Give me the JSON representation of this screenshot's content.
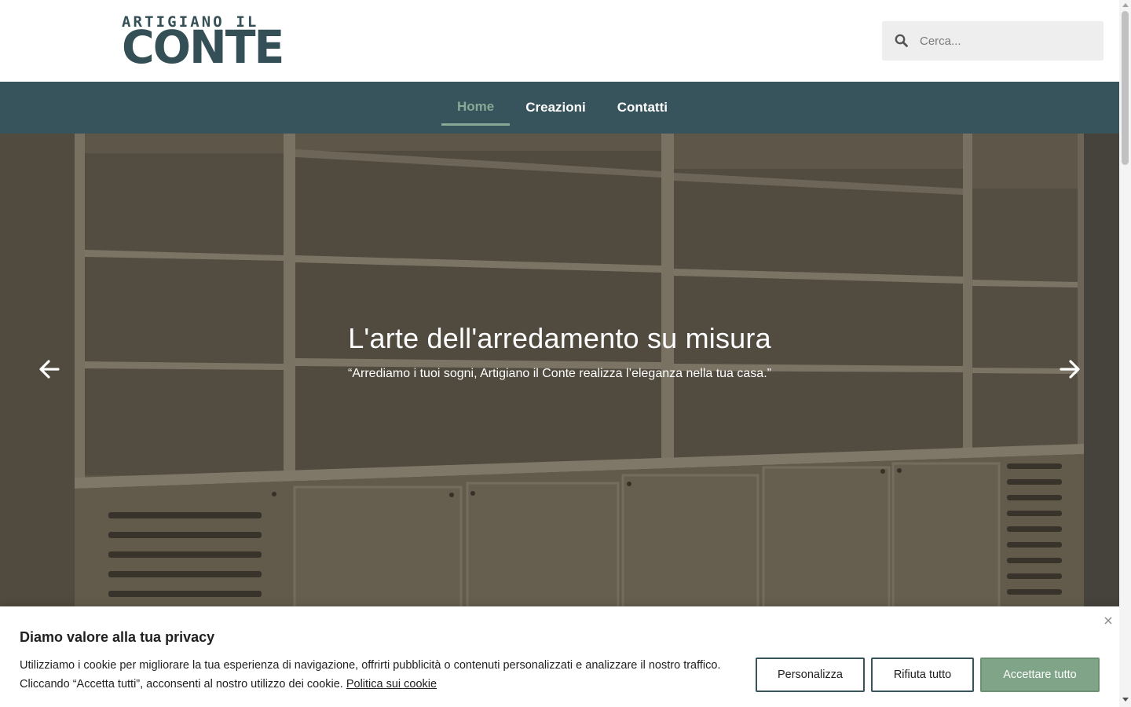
{
  "brand": {
    "logo_top": "ARTIGIANO IL",
    "logo_main": "CONTE"
  },
  "search": {
    "placeholder": "Cerca...",
    "icon": "search-icon"
  },
  "nav": {
    "items": [
      {
        "label": "Home",
        "active": true
      },
      {
        "label": "Creazioni",
        "active": false
      },
      {
        "label": "Contatti",
        "active": false
      }
    ]
  },
  "hero": {
    "title": "L'arte dell'arredamento su misura",
    "subtitle": "“Arrediamo i tuoi sogni, Artigiano il Conte realizza l’eleganza nella tua casa.”",
    "prev_icon": "arrow-left-icon",
    "next_icon": "arrow-right-icon"
  },
  "cookie": {
    "title": "Diamo valore alla tua privacy",
    "text_line1": "Utilizziamo i cookie per migliorare la tua esperienza di navigazione, offrirti pubblicità o contenuti personalizzati e analizzare il nostro traffico.",
    "text_line2": "Cliccando “Accetta tutti”, acconsenti al nostro utilizzo dei cookie.",
    "policy_link": "Politica sui cookie",
    "buttons": {
      "customize": "Personalizza",
      "reject": "Rifiuta tutto",
      "accept": "Accettare tutto"
    },
    "close_icon": "close-icon"
  },
  "colors": {
    "primary": "#37535b",
    "accent": "#8aa896",
    "accept_button": "#7fa488"
  }
}
